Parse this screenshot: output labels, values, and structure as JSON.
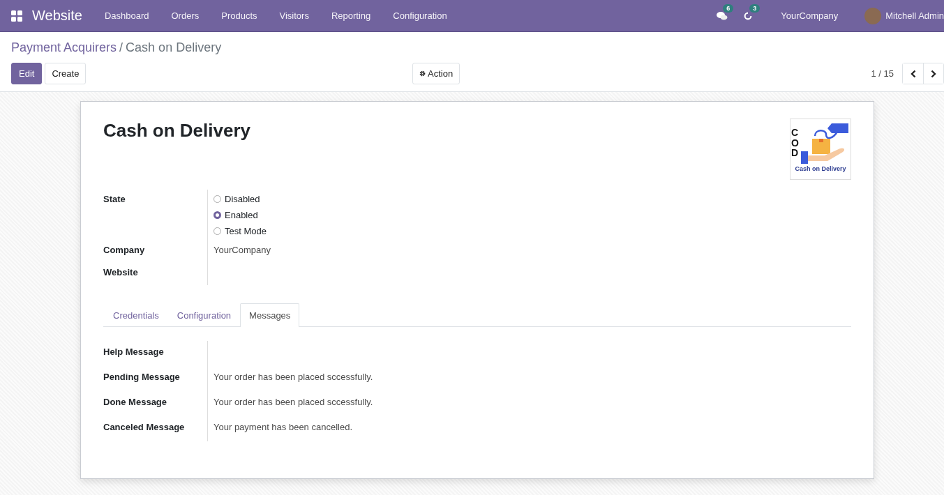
{
  "navbar": {
    "app_name": "Website",
    "menu": [
      "Dashboard",
      "Orders",
      "Products",
      "Visitors",
      "Reporting",
      "Configuration"
    ],
    "messages_count": "6",
    "activities_count": "3",
    "company": "YourCompany",
    "user": "Mitchell Admin"
  },
  "breadcrumb": {
    "parent": "Payment Acquirers",
    "separator": "/",
    "current": "Cash on Delivery"
  },
  "buttons": {
    "edit": "Edit",
    "create": "Create",
    "action": "Action"
  },
  "pager": {
    "value": "1 / 15"
  },
  "record": {
    "title": "Cash on Delivery",
    "logo": {
      "letters": "COD",
      "caption": "Cash on Delivery"
    },
    "state": {
      "label": "State",
      "options": [
        {
          "label": "Disabled",
          "selected": false
        },
        {
          "label": "Enabled",
          "selected": true
        },
        {
          "label": "Test Mode",
          "selected": false
        }
      ]
    },
    "fields": [
      {
        "label": "Company",
        "value": "YourCompany"
      },
      {
        "label": "Website"
      }
    ]
  },
  "tabs": [
    {
      "label": "Credentials",
      "selected": false
    },
    {
      "label": "Configuration",
      "selected": false
    },
    {
      "label": "Messages",
      "selected": true
    }
  ],
  "messages": [
    {
      "label": "Help Message"
    },
    {
      "label": "Pending Message",
      "value": "Your order has been placed sccessfully."
    },
    {
      "label": "Done Message",
      "value": "Your order has been placed sccessfully."
    },
    {
      "label": "Canceled Message",
      "value": "Your payment has been cancelled."
    }
  ]
}
